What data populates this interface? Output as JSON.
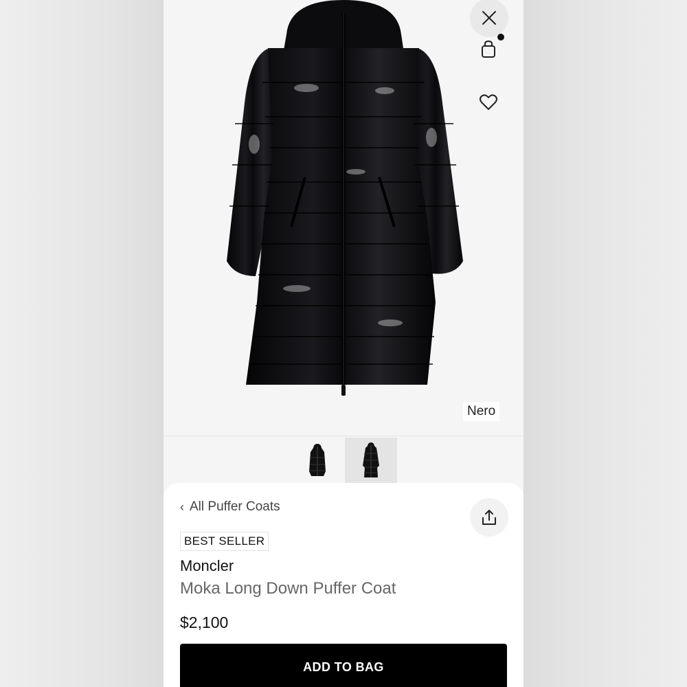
{
  "product": {
    "color_name": "Nero",
    "badge": "BEST SELLER",
    "brand": "Moncler",
    "name": "Moka Long Down Puffer Coat",
    "price": "$2,100"
  },
  "navigation": {
    "back_label": "All Puffer Coats"
  },
  "actions": {
    "add_to_bag_label": "ADD TO BAG"
  },
  "icons": {
    "close": "close-icon",
    "bag": "shopping-bag-icon",
    "favorite": "heart-icon",
    "share": "share-icon",
    "back": "chevron-left-icon"
  },
  "gallery": {
    "thumbnails": [
      "front-hooded-view",
      "full-length-view"
    ],
    "selected_index": 1
  },
  "colors": {
    "coat": "#0b0b0d",
    "button": "#000000",
    "sheet": "#ffffff",
    "page": "#f5f5f5"
  }
}
